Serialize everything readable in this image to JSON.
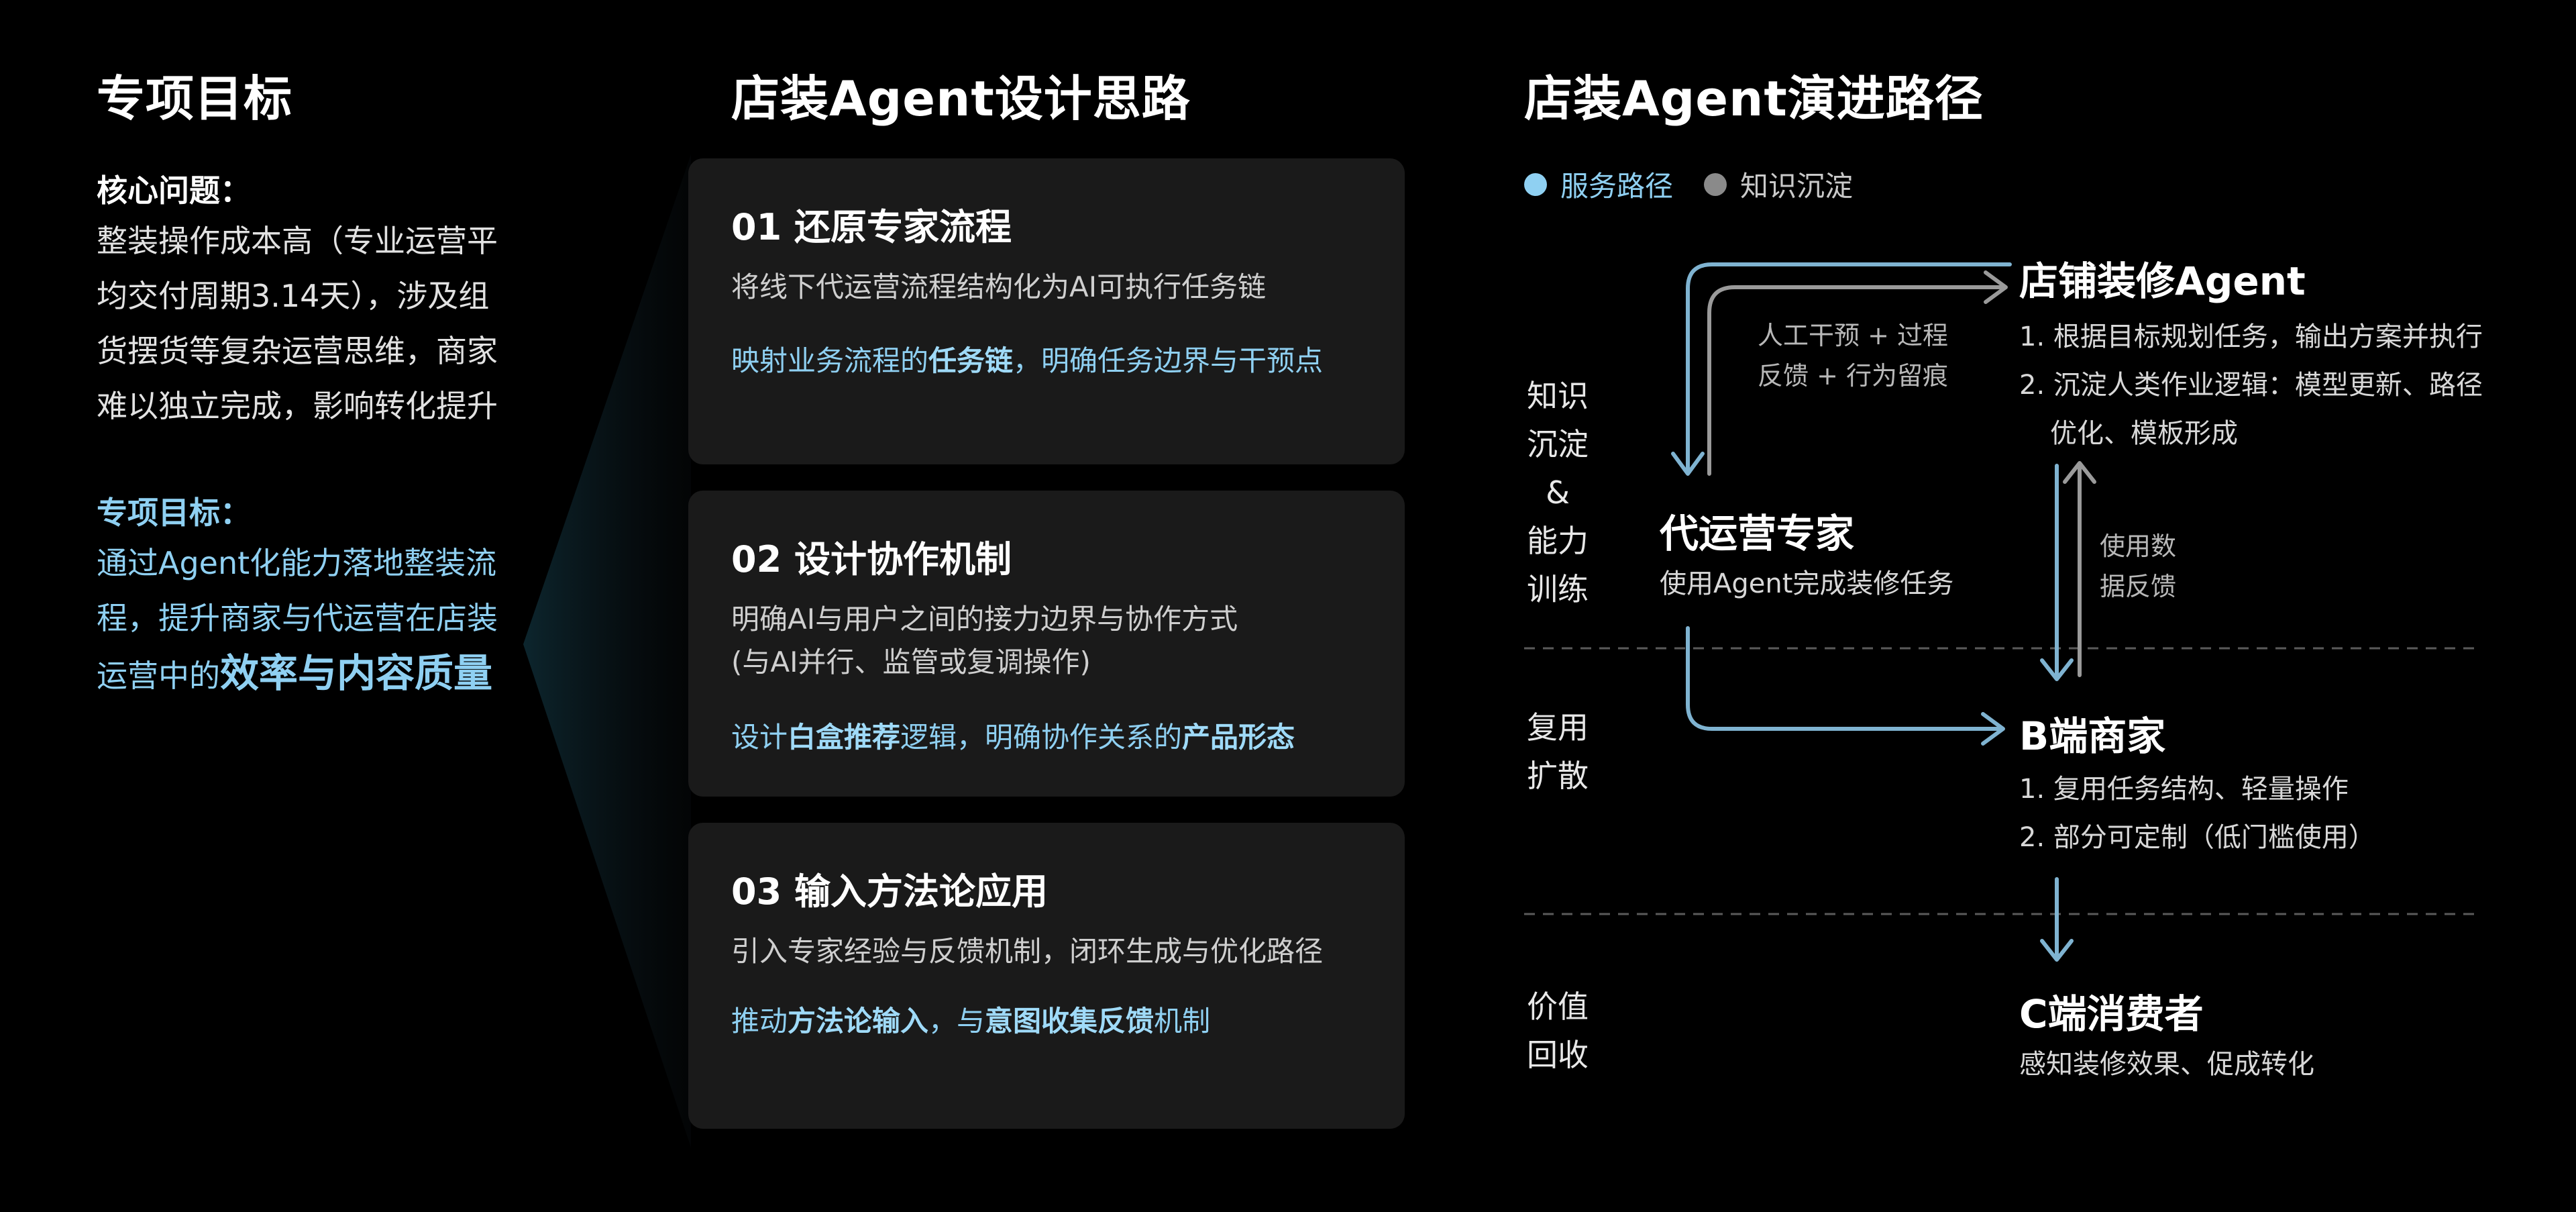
{
  "left": {
    "title": "专项目标",
    "core_label": "核心问题：",
    "core_lines": [
      "整装操作成本高（专业运营平",
      "均交付周期3.14天），涉及组",
      "货摆货等复杂运营思维，商家",
      "难以独立完成，影响转化提升"
    ],
    "goal_label": "专项目标：",
    "goal_lines": [
      "通过Agent化能力落地整装流",
      "程，提升商家与代运营在店装"
    ],
    "goal_last_prefix": "运营中的",
    "goal_last_em": "效率与内容质量"
  },
  "middle": {
    "title": "店装Agent设计思路",
    "cards": [
      {
        "title": "01 还原专家流程",
        "desc": "将线下代运营流程结构化为AI可执行任务链",
        "em_parts": [
          "映射业务流程的",
          "任务链",
          "，明确任务边界与干预点"
        ]
      },
      {
        "title": "02 设计协作机制",
        "desc1": "明确AI与用户之间的接力边界与协作方式",
        "desc2": "(与AI并行、监管或复调操作)",
        "em_parts": [
          "设计",
          "白盒推荐",
          "逻辑，明确协作关系的",
          "产品形态"
        ]
      },
      {
        "title": "03 输入方法论应用",
        "desc": "引入专家经验与反馈机制，闭环生成与优化路径",
        "em_parts": [
          "推动",
          "方法论输入",
          "，与",
          "意图收集反馈",
          "机制"
        ]
      }
    ]
  },
  "right": {
    "title": "店装Agent演进路径",
    "legend": [
      {
        "label": "服务路径",
        "color": "#8fd0f2"
      },
      {
        "label": "知识沉淀",
        "color": "#8a8a8a"
      }
    ],
    "stages": [
      {
        "lines": [
          "知识",
          "沉淀",
          "&",
          "能力",
          "训练"
        ]
      },
      {
        "lines": [
          "复用",
          "扩散"
        ]
      },
      {
        "lines": [
          "价值",
          "回收"
        ]
      }
    ],
    "nodes": {
      "agent": {
        "title": "店铺装修Agent",
        "lines": [
          "1. 根据目标规划任务，输出方案并执行",
          "2. 沉淀人类作业逻辑：模型更新、路径",
          "优化、模板形成"
        ]
      },
      "expert": {
        "title": "代运营专家",
        "lines": [
          "使用Agent完成装修任务"
        ]
      },
      "merchant": {
        "title": "B端商家",
        "lines": [
          "1. 复用任务结构、轻量操作",
          "2. 部分可定制（低门槛使用）"
        ]
      },
      "consumer": {
        "title": "C端消费者",
        "lines": [
          "感知装修效果、促成转化"
        ]
      }
    },
    "notes": {
      "intervention": [
        "人工干预 + 过程",
        "反馈 + 行为留痕"
      ],
      "feedback": [
        "使用数",
        "据反馈"
      ]
    }
  }
}
